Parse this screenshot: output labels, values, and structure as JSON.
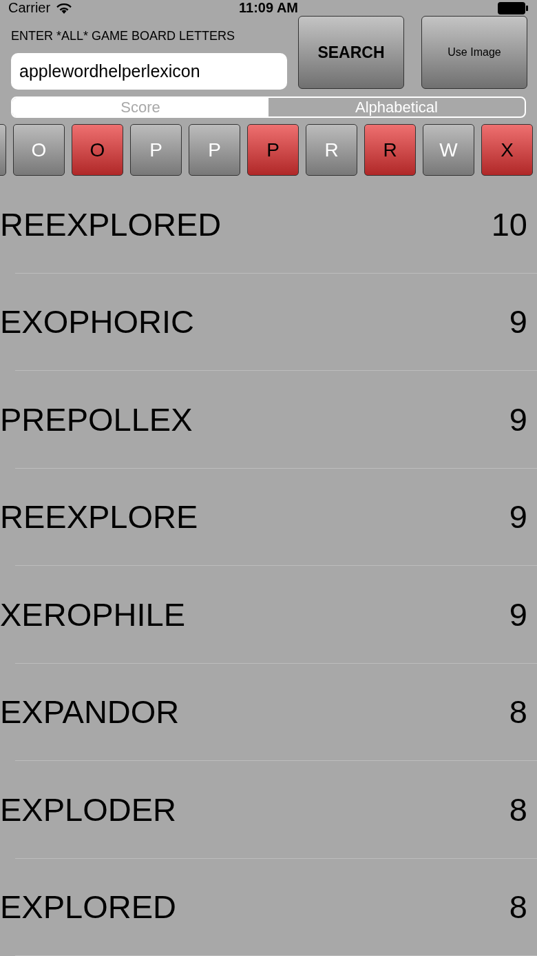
{
  "status_bar": {
    "carrier": "Carrier",
    "time": "11:09 AM"
  },
  "prompt": "ENTER *ALL* GAME BOARD LETTERS",
  "letters_field": {
    "value": "applewordhelperlexicon"
  },
  "buttons": [
    {
      "label": "SEARCH",
      "kind": "primary"
    },
    {
      "label": "Use Image",
      "kind": "secondary"
    }
  ],
  "sort_tabs": [
    {
      "label": "Score",
      "selected": true
    },
    {
      "label": "Alphabetical",
      "selected": false
    }
  ],
  "letter_tiles": [
    {
      "letter": "O",
      "selected": false
    },
    {
      "letter": "O",
      "selected": true
    },
    {
      "letter": "P",
      "selected": false
    },
    {
      "letter": "P",
      "selected": false
    },
    {
      "letter": "P",
      "selected": true
    },
    {
      "letter": "R",
      "selected": false
    },
    {
      "letter": "R",
      "selected": true
    },
    {
      "letter": "W",
      "selected": false
    },
    {
      "letter": "X",
      "selected": true
    }
  ],
  "results": [
    {
      "word": "REEXPLORED",
      "score": "10"
    },
    {
      "word": "EXOPHORIC",
      "score": "9"
    },
    {
      "word": "PREPOLLEX",
      "score": "9"
    },
    {
      "word": "REEXPLORE",
      "score": "9"
    },
    {
      "word": "XEROPHILE",
      "score": "9"
    },
    {
      "word": "EXPANDOR",
      "score": "8"
    },
    {
      "word": "EXPLODER",
      "score": "8"
    },
    {
      "word": "EXPLORED",
      "score": "8"
    }
  ]
}
